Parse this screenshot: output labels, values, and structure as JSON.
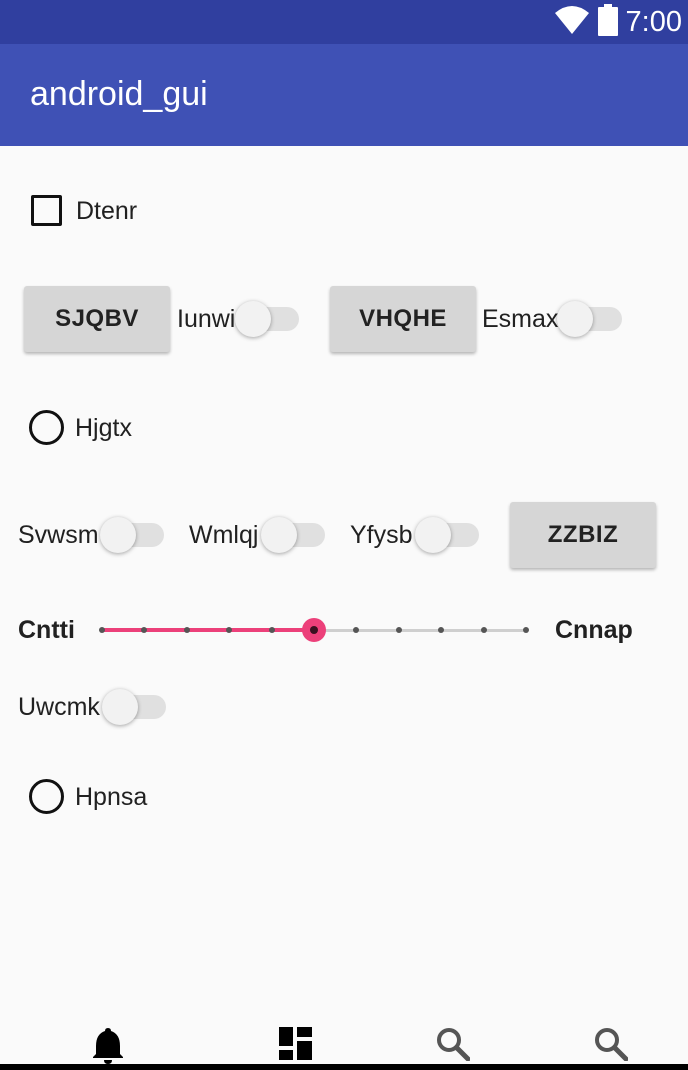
{
  "status_bar": {
    "time": "7:00",
    "icons": [
      "wifi-icon",
      "battery-icon"
    ]
  },
  "app_bar": {
    "title": "android_gui"
  },
  "checkbox": {
    "label": "Dtenr",
    "checked": false
  },
  "row1": {
    "button1": "SJQBV",
    "switch1_label": "Iunwi",
    "switch1_on": false,
    "button2": "VHQHE",
    "switch2_label": "Esmax",
    "switch2_on": false
  },
  "radio1": {
    "label": "Hjgtx",
    "selected": false
  },
  "row2": {
    "switch1_label": "Svwsm",
    "switch1_on": false,
    "switch2_label": "Wmlqj",
    "switch2_on": false,
    "switch3_label": "Yfysb",
    "switch3_on": false,
    "button": "ZZBIZ"
  },
  "slider": {
    "left_label": "Cntti",
    "right_label": "Cnnap",
    "min": 0,
    "max": 10,
    "value": 5,
    "accent_color": "#ec407a"
  },
  "switch_single": {
    "label": "Uwcmk",
    "on": false
  },
  "radio2": {
    "label": "Hpnsa",
    "selected": false
  },
  "bottom_nav": {
    "items": [
      "bell-icon",
      "dashboard-icon",
      "search-icon",
      "search-icon"
    ]
  },
  "colors": {
    "status_bar": "#303f9f",
    "app_bar": "#3f51b5",
    "accent": "#ec407a"
  }
}
